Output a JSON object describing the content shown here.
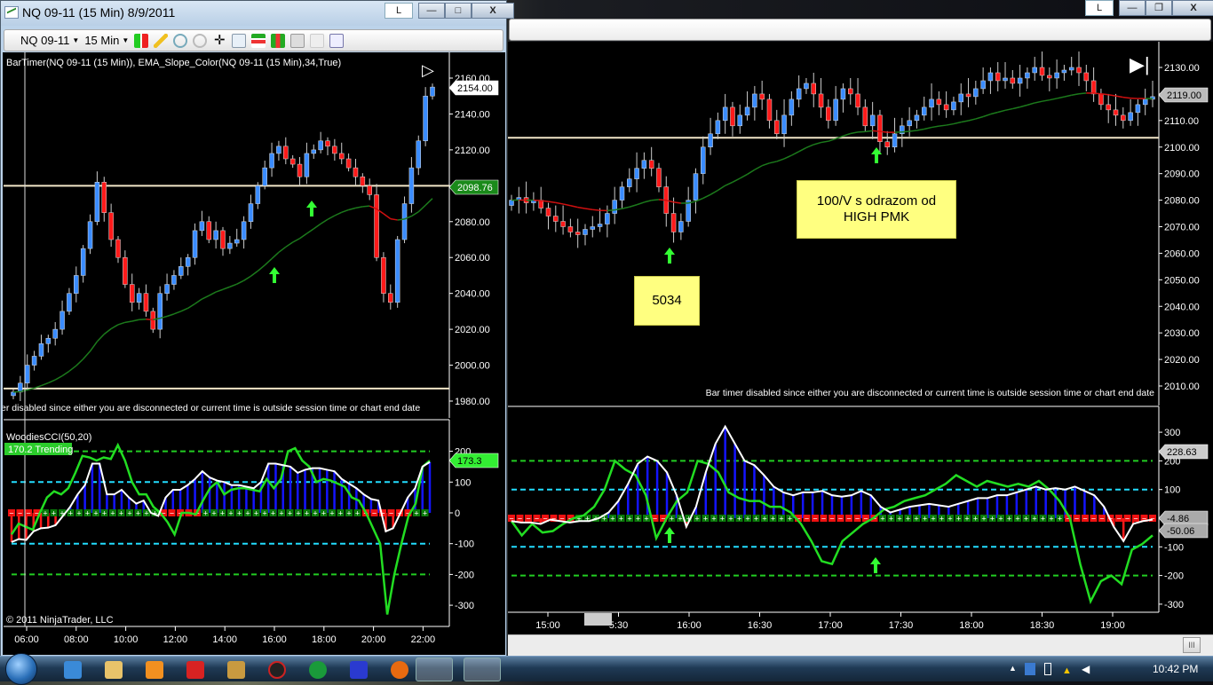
{
  "left_window": {
    "title": "NQ 09-11 (15 Min)  8/9/2011",
    "buttons": {
      "l": "L",
      "min": "—",
      "max": "□",
      "close": "X"
    },
    "toolbar": {
      "instrument": "NQ 09-11",
      "interval": "15 Min"
    },
    "indicator_label": "BarTimer(NQ 09-11 (15 Min)), EMA_Slope_Color(NQ 09-11 (15 Min),34,True)",
    "status_text": "er disabled since either you are disconnected or current time is outside session time or chart end date",
    "price_ticks": [
      "1980.00",
      "2000.00",
      "2020.00",
      "2040.00",
      "2060.00",
      "2080.00",
      "2100.00",
      "2120.00",
      "2140.00",
      "2160.00"
    ],
    "last_price": "2154.00",
    "ema_value": "2098.76",
    "cci_title": "WoodiesCCI(50,20)",
    "cci_trend": "170.2 Trending",
    "cci_value": "173.3",
    "cci_ticks": [
      "200",
      "100",
      "0",
      "-100",
      "-200",
      "-300"
    ],
    "copyright": "© 2011 NinjaTrader, LLC",
    "time_ticks": [
      "06:00",
      "08:00",
      "10:00",
      "12:00",
      "14:00",
      "16:00",
      "18:00",
      "20:00",
      "22:00"
    ],
    "closes": [
      1985,
      1990,
      2000,
      2005,
      2012,
      2015,
      2020,
      2030,
      2040,
      2050,
      2065,
      2080,
      2102,
      2085,
      2070,
      2060,
      2045,
      2035,
      2040,
      2030,
      2020,
      2040,
      2045,
      2050,
      2055,
      2060,
      2075,
      2080,
      2070,
      2075,
      2065,
      2068,
      2070,
      2080,
      2090,
      2100,
      2110,
      2118,
      2122,
      2115,
      2112,
      2105,
      2118,
      2120,
      2125,
      2122,
      2118,
      2115,
      2110,
      2105,
      2100,
      2095,
      2060,
      2040,
      2035,
      2070,
      2090,
      2110,
      2125,
      2150,
      2155
    ],
    "cci": [
      -95,
      -85,
      -88,
      -60,
      -50,
      -48,
      -40,
      -10,
      20,
      60,
      90,
      160,
      160,
      60,
      60,
      75,
      50,
      30,
      40,
      0,
      -10,
      50,
      75,
      75,
      90,
      110,
      135,
      115,
      105,
      100,
      90,
      90,
      85,
      80,
      100,
      160,
      160,
      155,
      150,
      130,
      140,
      145,
      145,
      140,
      135,
      110,
      95,
      80,
      60,
      45,
      40,
      -60,
      -50,
      0,
      50,
      80,
      150,
      165
    ],
    "turbo": [
      -70,
      -35,
      -45,
      -55,
      0,
      50,
      70,
      60,
      80,
      130,
      185,
      180,
      170,
      180,
      175,
      220,
      170,
      100,
      60,
      60,
      20,
      0,
      -30,
      -70,
      0,
      0,
      -5,
      40,
      80,
      100,
      60,
      75,
      80,
      80,
      75,
      70,
      110,
      80,
      110,
      200,
      210,
      170,
      150,
      100,
      110,
      105,
      95,
      85,
      50,
      40,
      0,
      -50,
      -100,
      -330,
      -200,
      -100,
      -10,
      30,
      150,
      170
    ]
  },
  "right_window": {
    "buttons": {
      "l": "L",
      "min": "—",
      "restore": "❐",
      "close": "X"
    },
    "status_text": "Bar timer disabled since either you are disconnected or current time is outside session time or chart end date",
    "price_ticks": [
      "2010.00",
      "2020.00",
      "2030.00",
      "2040.00",
      "2050.00",
      "2060.00",
      "2070.00",
      "2080.00",
      "2090.00",
      "2100.00",
      "2110.00",
      "2120.00",
      "2130.00"
    ],
    "last_price": "2119.00",
    "cci_ticks": [
      "300",
      "200",
      "100",
      "0",
      "-100",
      "-200",
      "-300"
    ],
    "cci_values": [
      "228.63",
      "-4.86",
      "-50.06"
    ],
    "time_ticks": [
      "15:00",
      "5:30",
      "16:00",
      "16:30",
      "17:00",
      "17:30",
      "18:00",
      "18:30",
      "19:00"
    ],
    "notes": [
      "5034",
      "100/V s odrazom od HIGH PMK"
    ],
    "closes": [
      2080,
      2081,
      2079,
      2080,
      2077,
      2074,
      2072,
      2070,
      2068,
      2067,
      2069,
      2070,
      2071,
      2075,
      2080,
      2085,
      2088,
      2092,
      2095,
      2092,
      2085,
      2075,
      2068,
      2072,
      2080,
      2090,
      2100,
      2105,
      2110,
      2115,
      2108,
      2112,
      2115,
      2120,
      2118,
      2110,
      2105,
      2112,
      2118,
      2122,
      2124,
      2120,
      2115,
      2110,
      2118,
      2122,
      2120,
      2115,
      2108,
      2112,
      2102,
      2100,
      2105,
      2108,
      2110,
      2112,
      2115,
      2118,
      2116,
      2114,
      2117,
      2120,
      2119,
      2122,
      2125,
      2128,
      2125,
      2126,
      2124,
      2126,
      2128,
      2130,
      2127,
      2126,
      2128,
      2129,
      2130,
      2128,
      2125,
      2120,
      2116,
      2114,
      2112,
      2110,
      2113,
      2116,
      2118,
      2119
    ],
    "cci": [
      -10,
      -15,
      -15,
      -20,
      -5,
      -10,
      -15,
      -10,
      -10,
      0,
      20,
      60,
      120,
      190,
      215,
      200,
      160,
      80,
      -30,
      40,
      160,
      260,
      320,
      260,
      200,
      185,
      150,
      110,
      90,
      80,
      90,
      90,
      95,
      80,
      75,
      80,
      95,
      80,
      40,
      20,
      30,
      40,
      45,
      50,
      45,
      40,
      50,
      60,
      70,
      70,
      80,
      80,
      90,
      100,
      110,
      100,
      105,
      100,
      110,
      95,
      80,
      40,
      -30,
      -80,
      -20,
      -10,
      -5
    ],
    "turbo": [
      -10,
      -60,
      -20,
      -50,
      -45,
      -20,
      0,
      10,
      40,
      100,
      200,
      170,
      150,
      80,
      -70,
      0,
      60,
      90,
      200,
      190,
      160,
      90,
      70,
      60,
      60,
      40,
      40,
      20,
      -20,
      -80,
      -150,
      -160,
      -80,
      -50,
      -20,
      0,
      30,
      40,
      60,
      70,
      80,
      100,
      120,
      150,
      130,
      110,
      130,
      120,
      110,
      120,
      110,
      130,
      100,
      60,
      0,
      -160,
      -290,
      -220,
      -200,
      -230,
      -110,
      -90,
      -60
    ]
  },
  "taskbar": {
    "clock": "10:42 PM"
  },
  "colors": {
    "up": "#3a8cff",
    "down": "#ff1a1a",
    "ema": "#1c7a1c",
    "cci": "#ffffff",
    "turbo": "#22dd22",
    "hist": "#1414ff"
  }
}
